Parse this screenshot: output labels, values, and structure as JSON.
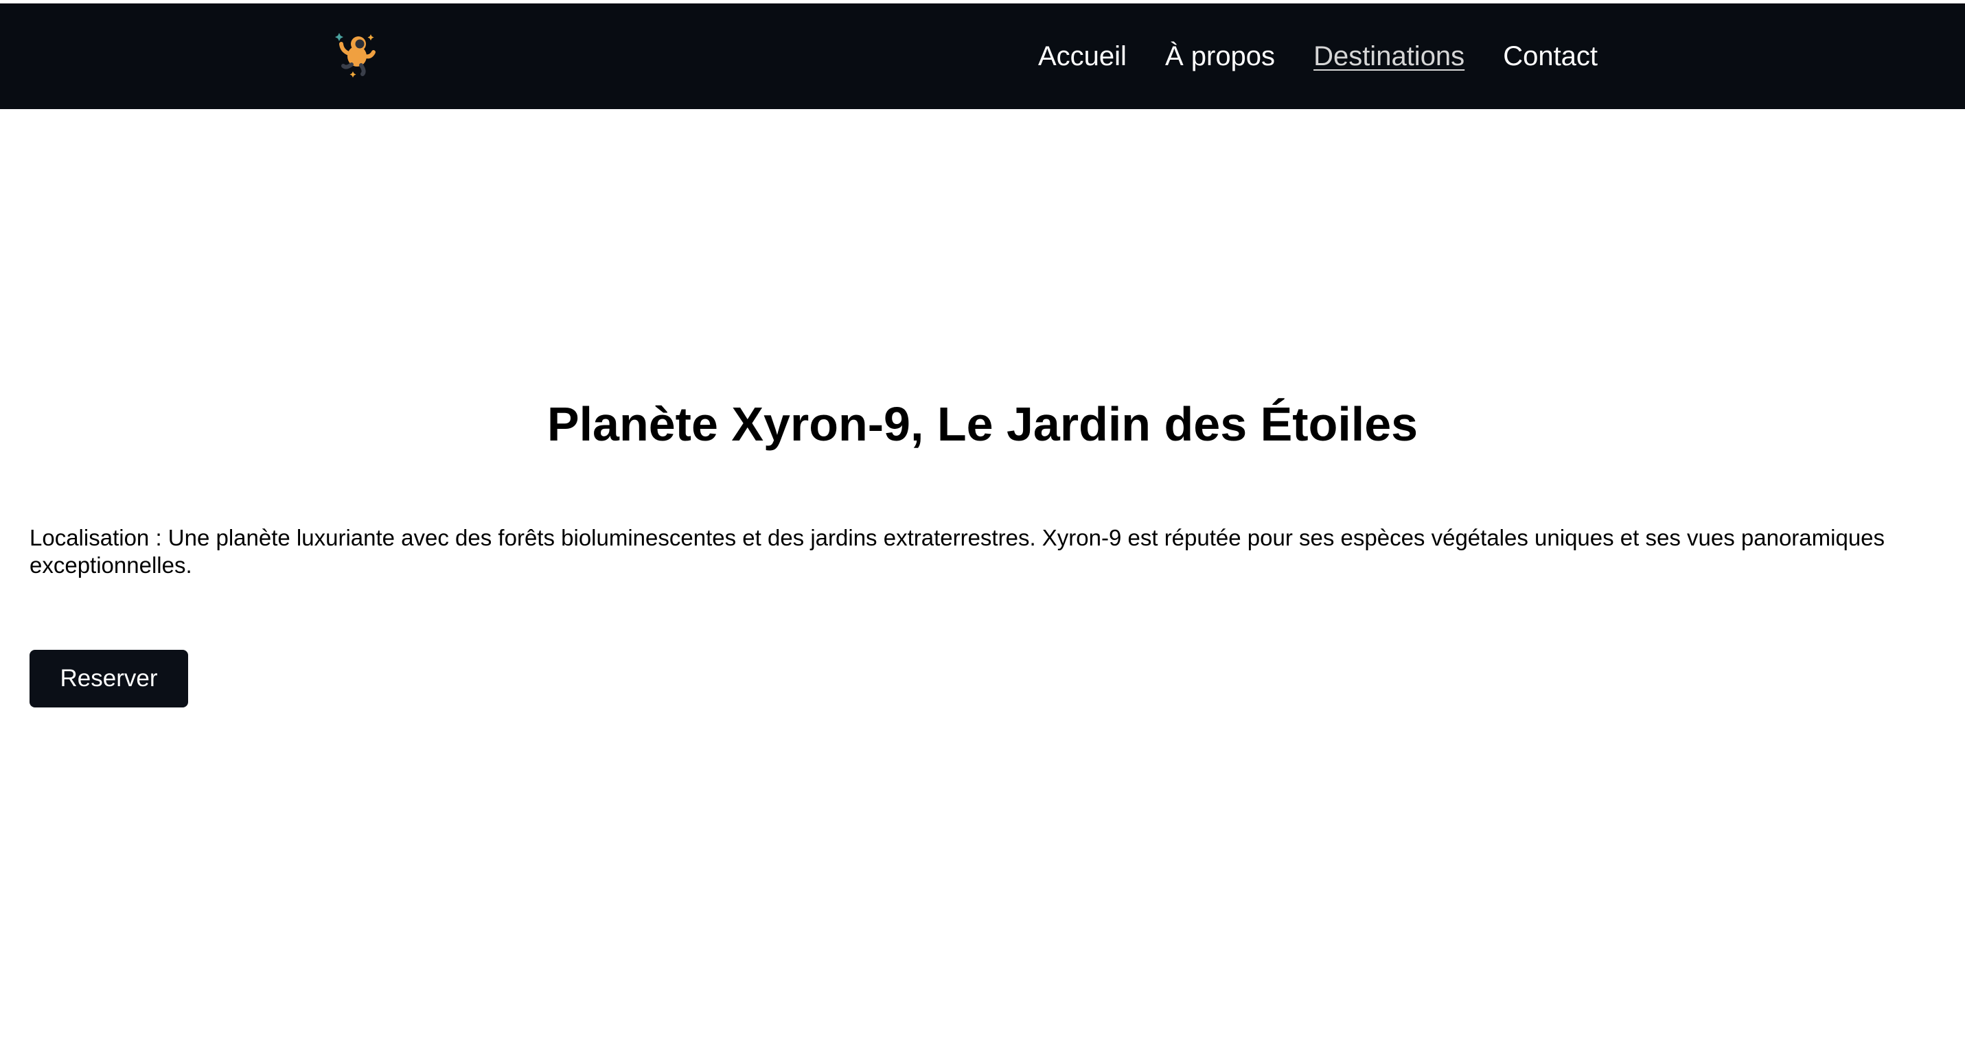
{
  "header": {
    "logo_icon": "astronaut-icon",
    "nav": [
      {
        "label": "Accueil",
        "active": false
      },
      {
        "label": "À propos",
        "active": false
      },
      {
        "label": "Destinations",
        "active": true
      },
      {
        "label": "Contact",
        "active": false
      }
    ]
  },
  "main": {
    "title": "Planète Xyron-9, Le Jardin des Étoiles",
    "description": "Localisation : Une planète luxuriante avec des forêts bioluminescentes et des jardins extraterrestres. Xyron-9 est réputée pour ses espèces végétales uniques et ses vues panoramiques exceptionnelles.",
    "reserve_label": "Reserver"
  },
  "colors": {
    "nav_background": "#080c12",
    "button_background": "#0b0f17",
    "active_link": "#d6d6d6"
  }
}
